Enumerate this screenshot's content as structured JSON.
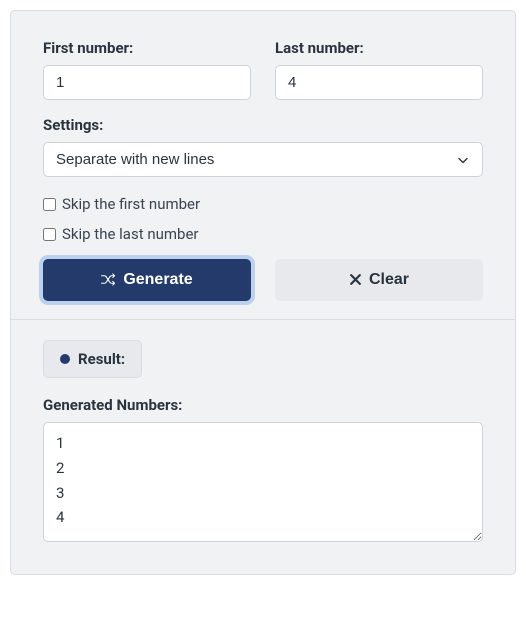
{
  "form": {
    "first_number": {
      "label": "First number:",
      "value": "1"
    },
    "last_number": {
      "label": "Last number:",
      "value": "4"
    },
    "settings": {
      "label": "Settings:",
      "selected": "Separate with new lines"
    },
    "skip_first": {
      "label": "Skip the first number",
      "checked": false
    },
    "skip_last": {
      "label": "Skip the last number",
      "checked": false
    }
  },
  "buttons": {
    "generate": "Generate",
    "clear": "Clear"
  },
  "result": {
    "badge": "Result:",
    "output_label": "Generated Numbers:",
    "output_value": "1\n2\n3\n4"
  }
}
